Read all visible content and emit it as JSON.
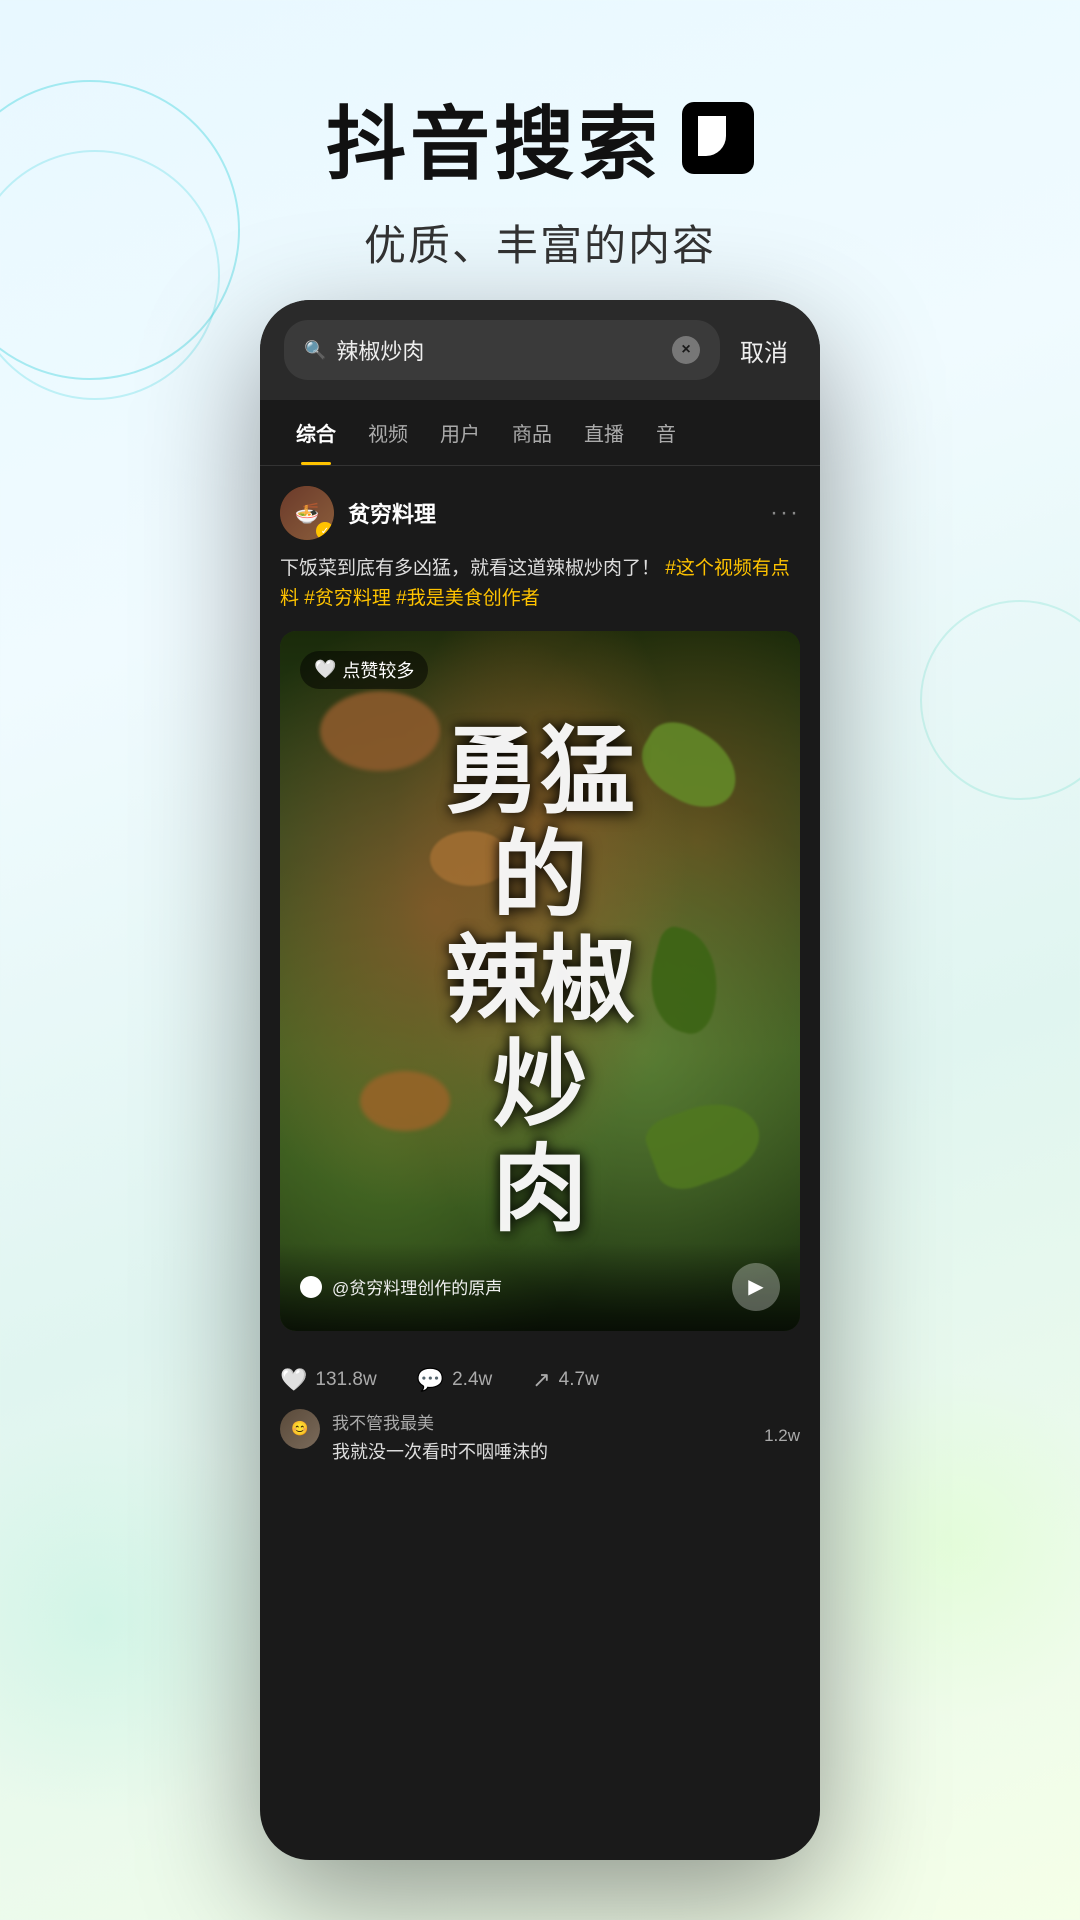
{
  "app": {
    "title": "抖音搜索",
    "logo_symbol": "♪",
    "subtitle": "优质、丰富的内容"
  },
  "phone": {
    "search": {
      "query": "辣椒炒肉",
      "clear_label": "×",
      "cancel_label": "取消"
    },
    "tabs": [
      {
        "id": "comprehensive",
        "label": "综合",
        "active": true
      },
      {
        "id": "video",
        "label": "视频",
        "active": false
      },
      {
        "id": "user",
        "label": "用户",
        "active": false
      },
      {
        "id": "product",
        "label": "商品",
        "active": false
      },
      {
        "id": "live",
        "label": "直播",
        "active": false
      },
      {
        "id": "audio",
        "label": "音",
        "active": false
      }
    ],
    "post": {
      "username": "贫穷料理",
      "description": "下饭菜到底有多凶猛，就看这道辣椒炒肉了！",
      "hashtags": [
        "#这个视频有点料",
        "#贫穷料理",
        "#我是美食创作者"
      ],
      "likes_badge": "点赞较多",
      "video_title": "勇\n猛\n的\n辣\n椒\n炒\n肉",
      "audio_info": "@贫穷料理创作的原声",
      "engagement": {
        "likes": "131.8w",
        "comments": "2.4w",
        "shares": "4.7w"
      },
      "comments": [
        {
          "user": "我不管我最美",
          "text": "我就没一次看时不咽唾沫的",
          "count": "1.2w"
        }
      ]
    }
  }
}
